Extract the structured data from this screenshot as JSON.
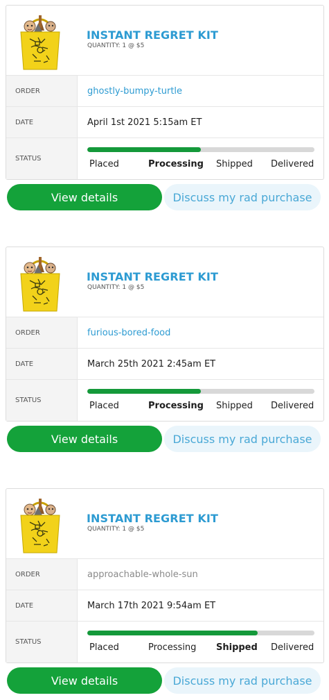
{
  "colors": {
    "accent_blue": "#2d9bd2",
    "progress_green": "#14993a",
    "view_button_green": "#14a23a",
    "discuss_button_bg": "#eaf5fb"
  },
  "labels": {
    "order": "ORDER",
    "date": "DATE",
    "status": "STATUS"
  },
  "status_steps": [
    "Placed",
    "Processing",
    "Shipped",
    "Delivered"
  ],
  "buttons": {
    "view": "View details",
    "discuss": "Discuss my rad purchase"
  },
  "orders": [
    {
      "product_icon": "yellow-tote-bag-icon",
      "product_name": "INSTANT REGRET KIT",
      "quantity_text": "QUANTITY: 1 @ $5",
      "order_id": "ghostly-bumpy-turtle",
      "order_id_style": "link",
      "date": "April 1st 2021 5:15am ET",
      "status": "Processing",
      "progress": 0.5
    },
    {
      "product_icon": "yellow-tote-bag-icon",
      "product_name": "INSTANT REGRET KIT",
      "quantity_text": "QUANTITY: 1 @ $5",
      "order_id": "furious-bored-food",
      "order_id_style": "link",
      "date": "March 25th 2021 2:45am ET",
      "status": "Processing",
      "progress": 0.5
    },
    {
      "product_icon": "yellow-tote-bag-icon",
      "product_name": "INSTANT REGRET KIT",
      "quantity_text": "QUANTITY: 1 @ $5",
      "order_id": "approachable-whole-sun",
      "order_id_style": "muted",
      "date": "March 17th 2021 9:54am ET",
      "status": "Shipped",
      "progress": 0.75
    }
  ]
}
